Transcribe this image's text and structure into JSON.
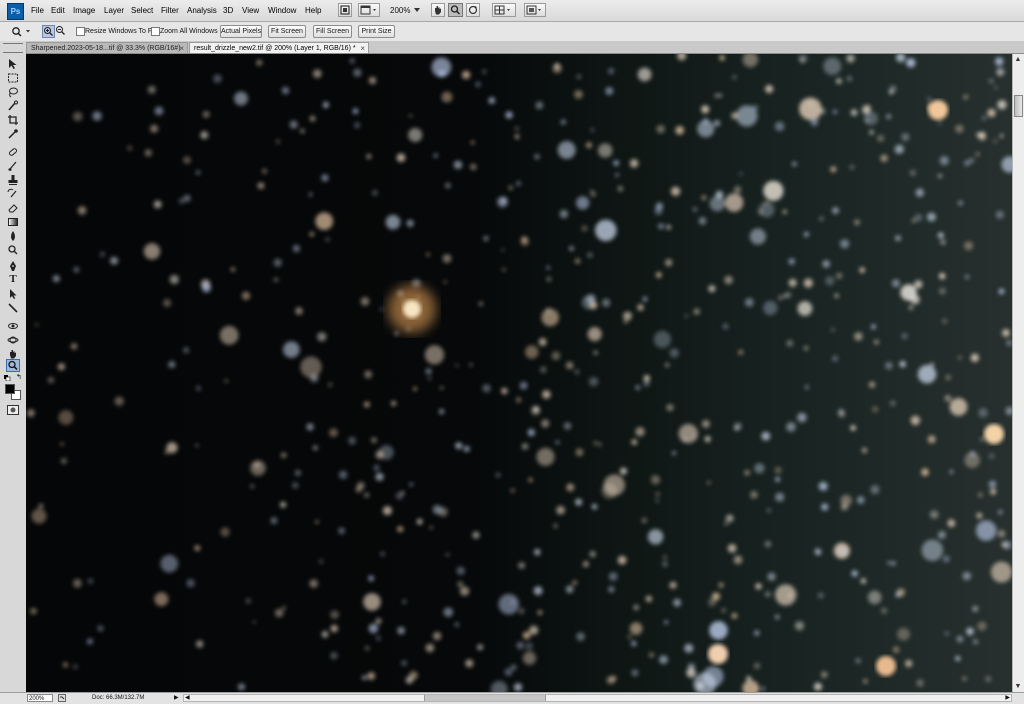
{
  "app": {
    "logo_text": "Ps",
    "menu": [
      "File",
      "Edit",
      "Image",
      "Layer",
      "Select",
      "Filter",
      "Analysis",
      "3D",
      "View",
      "Window",
      "Help"
    ],
    "zoom_level": "200%"
  },
  "options_bar": {
    "resize_windows_label": "Resize Windows To Fit",
    "zoom_all_windows_label": "Zoom All Windows",
    "actual_pixels_label": "Actual Pixels",
    "fit_screen_label": "Fit Screen",
    "fill_screen_label": "Fill Screen",
    "print_size_label": "Print Size"
  },
  "tabs": [
    {
      "label": "Sharpened.2023-05-18...tif @ 33.3% (RGB/16#)",
      "close": "×",
      "active": false
    },
    {
      "label": "result_drizzle_new2.tif @ 200% (Layer 1, RGB/16) *",
      "close": "×",
      "active": true
    }
  ],
  "status_bar": {
    "zoom": "200%",
    "doc_info": "Doc: 66.3M/132.7M"
  },
  "tools": [
    "move-tool",
    "marquee-tool",
    "lasso-tool",
    "quick-selection-tool",
    "crop-tool",
    "eyedropper-tool",
    "spot-healing-tool",
    "brush-tool",
    "clone-stamp-tool",
    "history-brush-tool",
    "eraser-tool",
    "gradient-tool",
    "blur-tool",
    "dodge-tool",
    "pen-tool",
    "type-tool",
    "path-selection-tool",
    "line-tool",
    "3d-rotate-tool",
    "3d-orbit-tool",
    "hand-tool",
    "zoom-tool"
  ],
  "colors": {
    "foreground": "#000000",
    "background": "#ffffff",
    "canvas_bg": "#050607",
    "active_tab": "#f2f2f2",
    "menu_bg": "#e0e0e0"
  }
}
